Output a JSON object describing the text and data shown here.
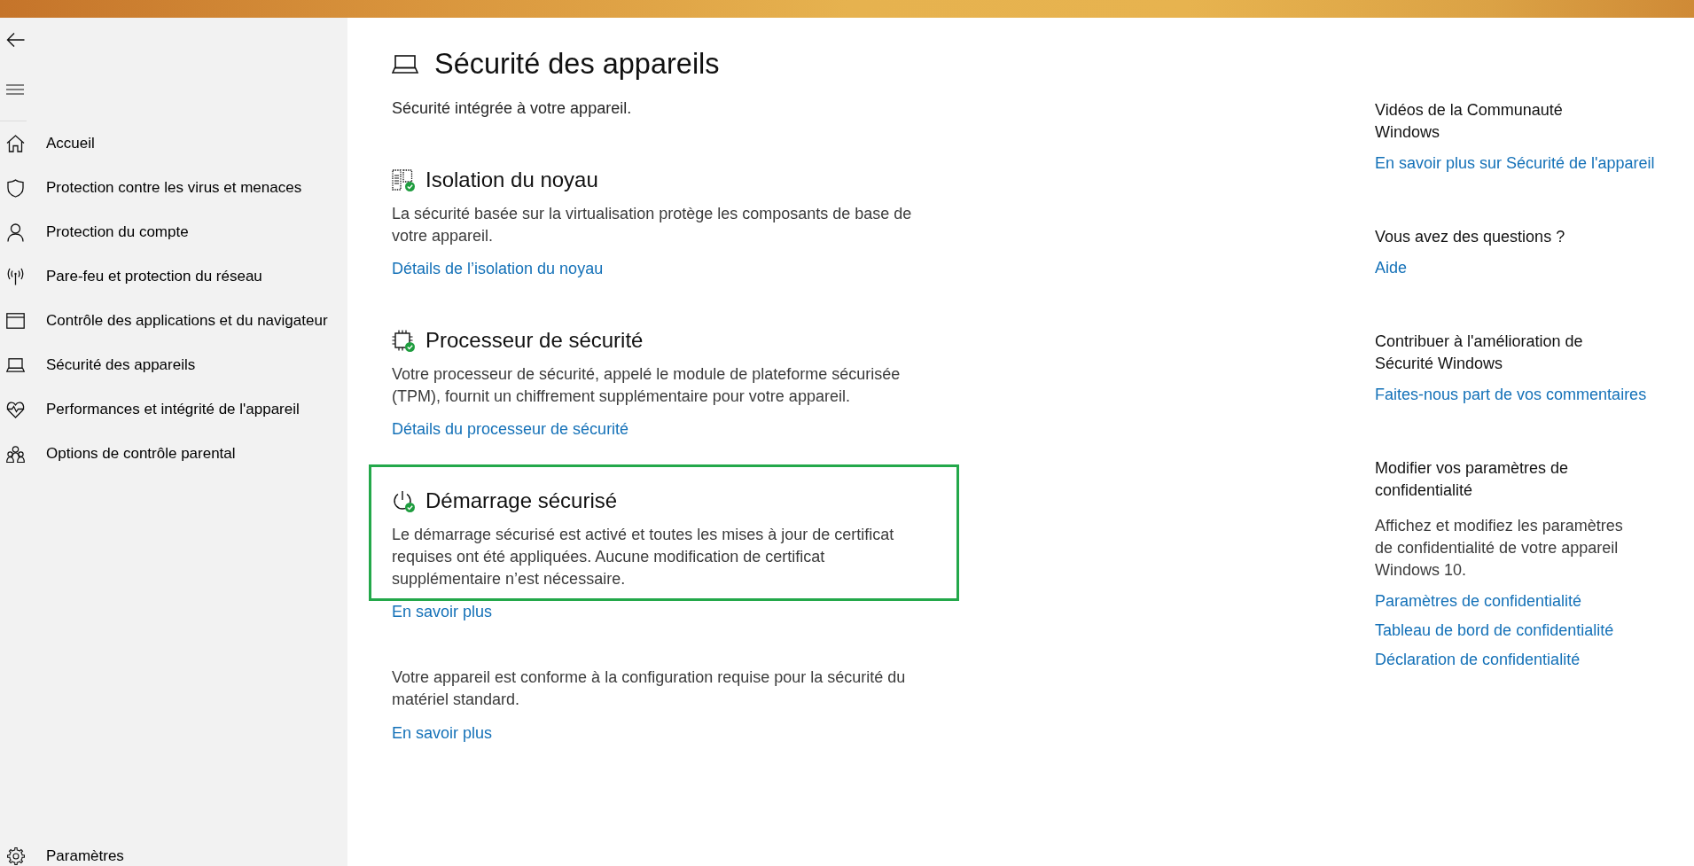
{
  "sidebar": {
    "items": [
      {
        "label": "Accueil"
      },
      {
        "label": "Protection contre les virus et menaces"
      },
      {
        "label": "Protection du compte"
      },
      {
        "label": "Pare-feu et protection du réseau"
      },
      {
        "label": "Contrôle des applications et du navigateur"
      },
      {
        "label": "Sécurité des appareils"
      },
      {
        "label": "Performances et intégrité de l'appareil"
      },
      {
        "label": "Options de contrôle parental"
      }
    ],
    "footer_item": {
      "label": "Paramètres"
    }
  },
  "page": {
    "title": "Sécurité des appareils",
    "subtitle": "Sécurité intégrée à votre appareil."
  },
  "sections": [
    {
      "heading": "Isolation du noyau",
      "description": "La sécurité basée sur la virtualisation protège les composants de base de votre appareil.",
      "link": "Détails de l’isolation du noyau",
      "ok": true,
      "highlighted": false
    },
    {
      "heading": "Processeur de sécurité",
      "description": "Votre processeur de sécurité, appelé le module de plateforme sécurisée (TPM), fournit un chiffrement supplémentaire pour votre appareil.",
      "link": "Détails du processeur de sécurité",
      "ok": true,
      "highlighted": false
    },
    {
      "heading": "Démarrage sécurisé",
      "description": "Le démarrage sécurisé est activé et toutes les mises à jour de certificat requises ont été appliquées. Aucune modification de certificat supplémentaire n’est nécessaire.",
      "link": "En savoir plus",
      "ok": true,
      "highlighted": true
    }
  ],
  "compliance": {
    "text": "Votre appareil est conforme à la configuration requise pour la sécurité du matériel standard.",
    "link": "En savoir plus"
  },
  "aside": {
    "groups": [
      {
        "heading": "Vidéos de la Communauté Windows",
        "links": [
          "En savoir plus sur Sécurité de l'appareil"
        ]
      },
      {
        "heading": "Vous avez des questions ?",
        "links": [
          "Aide"
        ]
      },
      {
        "heading": "Contribuer à l'amélioration de Sécurité Windows",
        "links": [
          "Faites-nous part de vos commentaires"
        ]
      },
      {
        "heading": "Modifier vos paramètres de confidentialité",
        "description": "Affichez et modifiez les paramètres de confidentialité de votre appareil Windows 10.",
        "links": [
          "Paramètres de confidentialité",
          "Tableau de bord de confidentialité",
          "Déclaration de confidentialité"
        ]
      }
    ]
  }
}
